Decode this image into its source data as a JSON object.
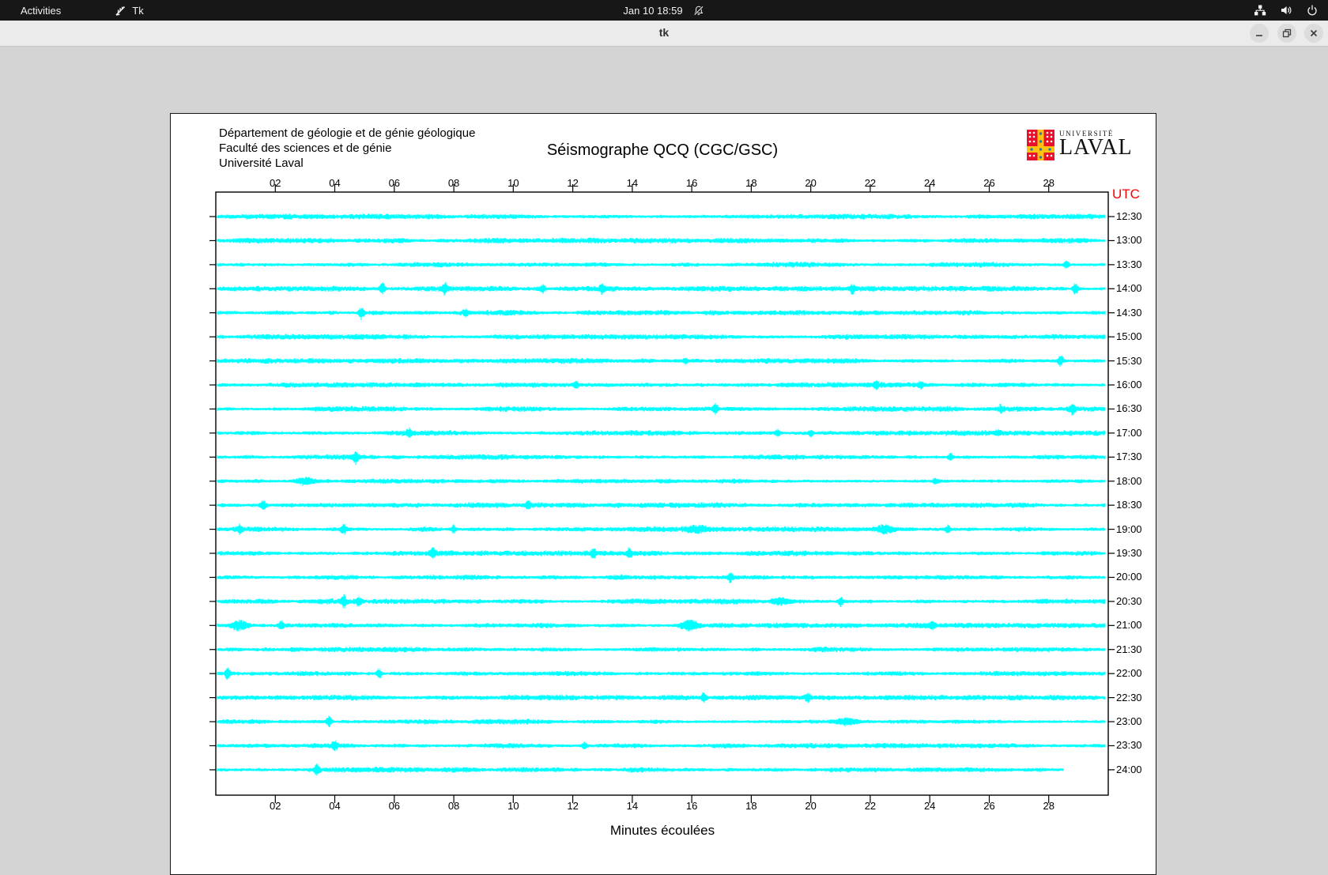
{
  "top_bar": {
    "activities_label": "Activities",
    "app_name": "Tk",
    "clock": "Jan 10  18:59",
    "icons": [
      "tk-feather-icon",
      "bell-muted-icon",
      "network-icon",
      "volume-icon",
      "power-icon"
    ]
  },
  "titlebar": {
    "title": "tk",
    "buttons": [
      "minimize",
      "restore",
      "close"
    ]
  },
  "panel": {
    "address_lines": [
      "Département de géologie et de génie géologique",
      "Faculté des sciences et de génie",
      "Université Laval"
    ],
    "title": "Séismographe QCQ (CGC/GSC)",
    "logo": {
      "top": "UNIVERSITÉ",
      "bottom": "LAVAL"
    },
    "utc_label": "UTC",
    "x_axis_label": "Minutes écoulées"
  },
  "chart_data": {
    "type": "line",
    "description": "Helicorder-style seismogram: 24 half-hour traces (rows), x = minutes elapsed 0-30, row label = UTC start time of the half hour. Events are visible spike bursts at approximate minute positions with relative amplitude (px) and optional width (minutes).",
    "trace_color": "#00ffff",
    "xlim_minutes": [
      0,
      30
    ],
    "x_ticks": [
      "02",
      "04",
      "06",
      "08",
      "10",
      "12",
      "14",
      "16",
      "18",
      "20",
      "22",
      "24",
      "26",
      "28"
    ],
    "x_tick_minutes": [
      2,
      4,
      6,
      8,
      10,
      12,
      14,
      16,
      18,
      20,
      22,
      24,
      26,
      28
    ],
    "rows": [
      {
        "time": "12:30",
        "end_minute": 29.9,
        "events": []
      },
      {
        "time": "13:00",
        "end_minute": 29.9,
        "events": []
      },
      {
        "time": "13:30",
        "end_minute": 29.9,
        "events": [
          {
            "m": 28.6,
            "a": 5
          }
        ]
      },
      {
        "time": "14:00",
        "end_minute": 29.9,
        "events": [
          {
            "m": 5.6,
            "a": 7
          },
          {
            "m": 7.7,
            "a": 6
          },
          {
            "m": 11.0,
            "a": 5
          },
          {
            "m": 13.0,
            "a": 5
          },
          {
            "m": 21.4,
            "a": 5
          },
          {
            "m": 28.9,
            "a": 7
          }
        ]
      },
      {
        "time": "14:30",
        "end_minute": 29.9,
        "events": [
          {
            "m": 4.9,
            "a": 8
          },
          {
            "m": 8.4,
            "a": 4
          }
        ]
      },
      {
        "time": "15:00",
        "end_minute": 29.9,
        "events": []
      },
      {
        "time": "15:30",
        "end_minute": 29.9,
        "events": [
          {
            "m": 15.8,
            "a": 3
          },
          {
            "m": 28.4,
            "a": 7
          }
        ]
      },
      {
        "time": "16:00",
        "end_minute": 29.9,
        "events": [
          {
            "m": 12.1,
            "a": 4
          },
          {
            "m": 22.2,
            "a": 4
          },
          {
            "m": 23.7,
            "a": 3
          }
        ]
      },
      {
        "time": "16:30",
        "end_minute": 29.9,
        "events": [
          {
            "m": 16.8,
            "a": 5
          },
          {
            "m": 26.4,
            "a": 4
          },
          {
            "m": 28.8,
            "a": 6
          }
        ]
      },
      {
        "time": "17:00",
        "end_minute": 29.9,
        "events": [
          {
            "m": 6.5,
            "a": 4
          },
          {
            "m": 18.9,
            "a": 3.5
          },
          {
            "m": 20.0,
            "a": 3.5
          },
          {
            "m": 26.3,
            "a": 3.5
          }
        ]
      },
      {
        "time": "17:30",
        "end_minute": 29.9,
        "events": [
          {
            "m": 4.7,
            "a": 6
          },
          {
            "m": 24.7,
            "a": 4
          }
        ]
      },
      {
        "time": "18:00",
        "end_minute": 29.9,
        "events": [
          {
            "m": 3.0,
            "a": 4,
            "w": 0.3
          },
          {
            "m": 24.2,
            "a": 3
          }
        ]
      },
      {
        "time": "18:30",
        "end_minute": 29.9,
        "events": [
          {
            "m": 1.6,
            "a": 5
          },
          {
            "m": 10.5,
            "a": 5
          }
        ]
      },
      {
        "time": "19:00",
        "end_minute": 29.9,
        "events": [
          {
            "m": 0.8,
            "a": 5
          },
          {
            "m": 4.3,
            "a": 5
          },
          {
            "m": 8.0,
            "a": 4
          },
          {
            "m": 16.2,
            "a": 3.5,
            "w": 0.3
          },
          {
            "m": 22.5,
            "a": 4,
            "w": 0.3
          },
          {
            "m": 24.6,
            "a": 4
          }
        ]
      },
      {
        "time": "19:30",
        "end_minute": 29.9,
        "events": [
          {
            "m": 7.3,
            "a": 6
          },
          {
            "m": 12.7,
            "a": 5
          },
          {
            "m": 13.9,
            "a": 5
          }
        ]
      },
      {
        "time": "20:00",
        "end_minute": 29.9,
        "events": [
          {
            "m": 17.3,
            "a": 5
          }
        ]
      },
      {
        "time": "20:30",
        "end_minute": 29.9,
        "events": [
          {
            "m": 4.3,
            "a": 7
          },
          {
            "m": 4.8,
            "a": 5
          },
          {
            "m": 19.0,
            "a": 4,
            "w": 0.3
          },
          {
            "m": 21.0,
            "a": 5
          }
        ]
      },
      {
        "time": "21:00",
        "end_minute": 29.9,
        "events": [
          {
            "m": 0.8,
            "a": 6,
            "w": 0.3
          },
          {
            "m": 2.2,
            "a": 5
          },
          {
            "m": 15.9,
            "a": 6,
            "w": 0.3
          },
          {
            "m": 24.1,
            "a": 4
          }
        ]
      },
      {
        "time": "21:30",
        "end_minute": 29.9,
        "events": []
      },
      {
        "time": "22:00",
        "end_minute": 29.9,
        "events": [
          {
            "m": 0.4,
            "a": 7
          },
          {
            "m": 5.5,
            "a": 6
          }
        ]
      },
      {
        "time": "22:30",
        "end_minute": 29.9,
        "events": [
          {
            "m": 16.4,
            "a": 5
          },
          {
            "m": 19.9,
            "a": 5
          }
        ]
      },
      {
        "time": "23:00",
        "end_minute": 29.9,
        "events": [
          {
            "m": 3.8,
            "a": 6
          },
          {
            "m": 21.2,
            "a": 4,
            "w": 0.35
          }
        ]
      },
      {
        "time": "23:30",
        "end_minute": 29.9,
        "events": [
          {
            "m": 4.0,
            "a": 5
          },
          {
            "m": 12.4,
            "a": 4
          }
        ]
      },
      {
        "time": "24:00",
        "end_minute": 28.5,
        "events": [
          {
            "m": 3.4,
            "a": 6
          }
        ]
      }
    ]
  }
}
